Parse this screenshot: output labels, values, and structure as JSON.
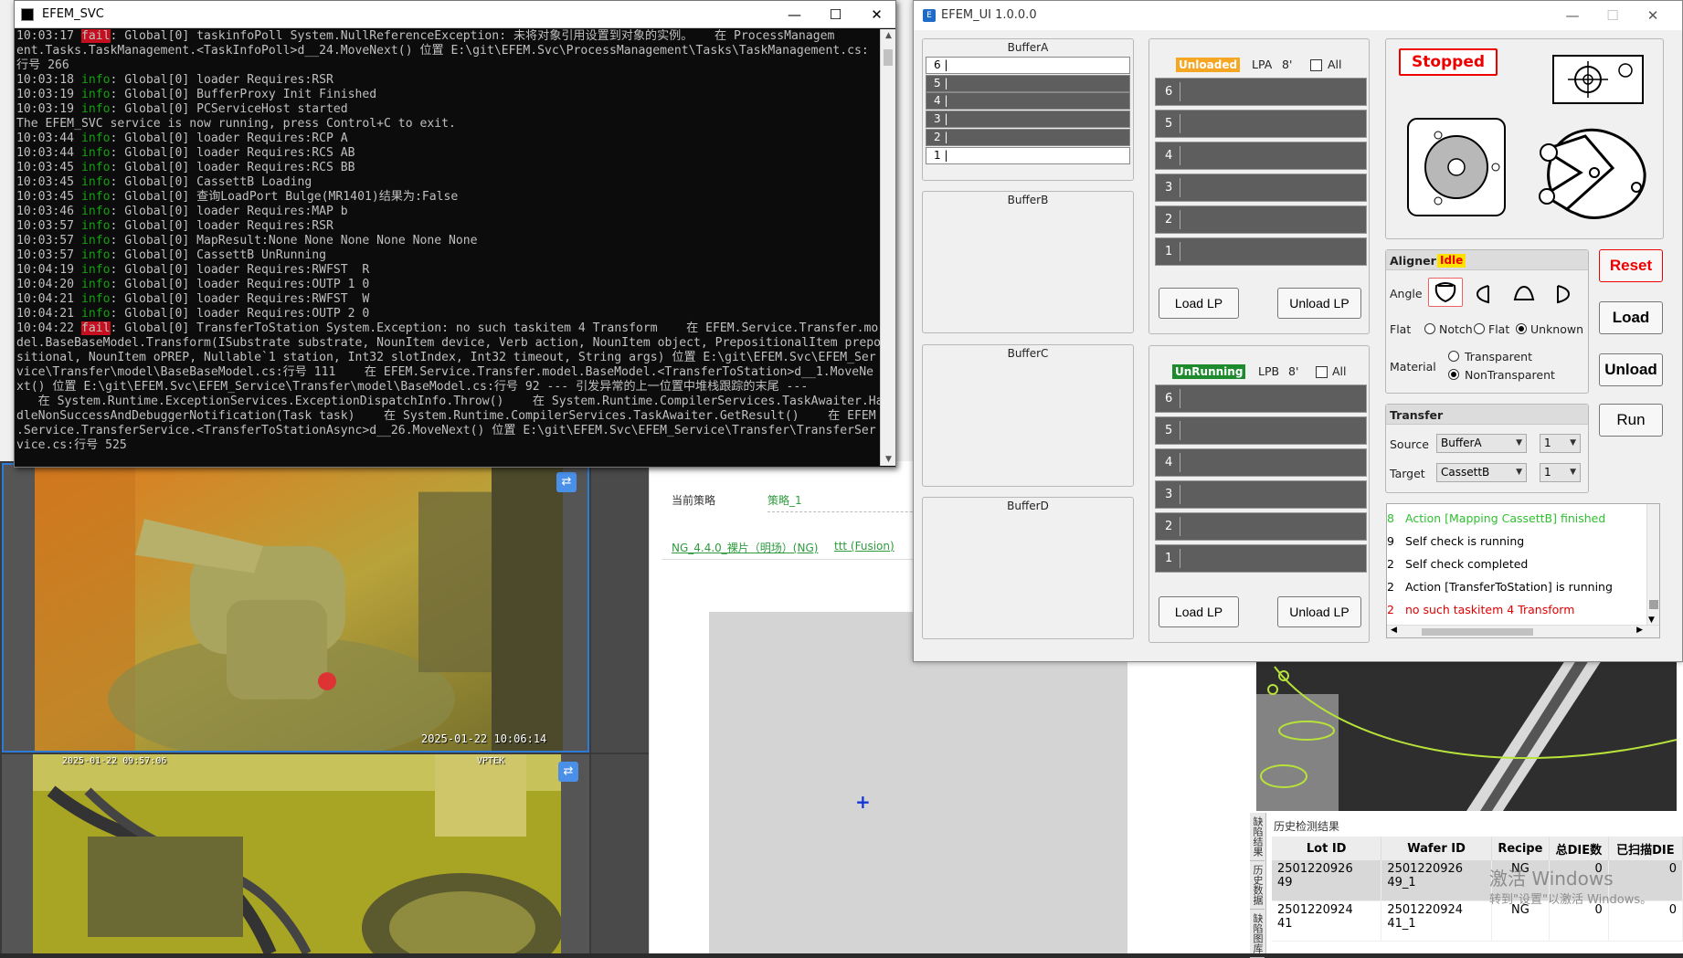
{
  "console": {
    "title": "EFEM_SVC",
    "lines": [
      [
        {
          "t": "10:03:17 "
        },
        {
          "t": "fail",
          "c": "fail"
        },
        {
          "t": ": Global[0] taskinfoPoll System.NullReferenceException: 未将对象引用设置到对象的实例。   在 ProcessManagem"
        }
      ],
      [
        {
          "t": "ent.Tasks.TaskManagement.<TaskInfoPoll>d__24.MoveNext() 位置 E:\\git\\EFEM.Svc\\ProcessManagement\\Tasks\\TaskManagement.cs:"
        }
      ],
      [
        {
          "t": "行号 266"
        }
      ],
      [
        {
          "t": "10:03:18 "
        },
        {
          "t": "info",
          "c": "info"
        },
        {
          "t": ": Global[0] loader Requires:RSR"
        }
      ],
      [
        {
          "t": "10:03:19 "
        },
        {
          "t": "info",
          "c": "info"
        },
        {
          "t": ": Global[0] BufferProxy Init Finished"
        }
      ],
      [
        {
          "t": "10:03:19 "
        },
        {
          "t": "info",
          "c": "info"
        },
        {
          "t": ": Global[0] PCServiceHost started"
        }
      ],
      [
        {
          "t": "The EFEM_SVC service is now running, press Control+C to exit."
        }
      ],
      [
        {
          "t": "10:03:44 "
        },
        {
          "t": "info",
          "c": "info"
        },
        {
          "t": ": Global[0] loader Requires:RCP A"
        }
      ],
      [
        {
          "t": "10:03:44 "
        },
        {
          "t": "info",
          "c": "info"
        },
        {
          "t": ": Global[0] loader Requires:RCS AB"
        }
      ],
      [
        {
          "t": "10:03:45 "
        },
        {
          "t": "info",
          "c": "info"
        },
        {
          "t": ": Global[0] loader Requires:RCS BB"
        }
      ],
      [
        {
          "t": "10:03:45 "
        },
        {
          "t": "info",
          "c": "info"
        },
        {
          "t": ": Global[0] CassettB Loading"
        }
      ],
      [
        {
          "t": "10:03:45 "
        },
        {
          "t": "info",
          "c": "info"
        },
        {
          "t": ": Global[0] 查询LoadPort Bulge(MR1401)结果为:False"
        }
      ],
      [
        {
          "t": "10:03:46 "
        },
        {
          "t": "info",
          "c": "info"
        },
        {
          "t": ": Global[0] loader Requires:MAP b"
        }
      ],
      [
        {
          "t": "10:03:57 "
        },
        {
          "t": "info",
          "c": "info"
        },
        {
          "t": ": Global[0] loader Requires:RSR"
        }
      ],
      [
        {
          "t": "10:03:57 "
        },
        {
          "t": "info",
          "c": "info"
        },
        {
          "t": ": Global[0] MapResult:None None None None None None"
        }
      ],
      [
        {
          "t": "10:03:57 "
        },
        {
          "t": "info",
          "c": "info"
        },
        {
          "t": ": Global[0] CassettB UnRunning"
        }
      ],
      [
        {
          "t": "10:04:19 "
        },
        {
          "t": "info",
          "c": "info"
        },
        {
          "t": ": Global[0] loader Requires:RWFST  R"
        }
      ],
      [
        {
          "t": "10:04:20 "
        },
        {
          "t": "info",
          "c": "info"
        },
        {
          "t": ": Global[0] loader Requires:OUTP 1 0"
        }
      ],
      [
        {
          "t": "10:04:21 "
        },
        {
          "t": "info",
          "c": "info"
        },
        {
          "t": ": Global[0] loader Requires:RWFST  W"
        }
      ],
      [
        {
          "t": "10:04:21 "
        },
        {
          "t": "info",
          "c": "info"
        },
        {
          "t": ": Global[0] loader Requires:OUTP 2 0"
        }
      ],
      [
        {
          "t": "10:04:22 "
        },
        {
          "t": "fail",
          "c": "fail"
        },
        {
          "t": ": Global[0] TransferToStation System.Exception: no such taskitem 4 Transform    在 EFEM.Service.Transfer.mo"
        }
      ],
      [
        {
          "t": "del.BaseBaseModel.Transform(ISubstrate substrate, NounItem device, Verb action, NounItem object, PrepositionalItem prepo"
        }
      ],
      [
        {
          "t": "sitional, NounItem oPREP, Nullable`1 station, Int32 slotIndex, Int32 timeout, String args) 位置 E:\\git\\EFEM.Svc\\EFEM_Ser"
        }
      ],
      [
        {
          "t": "vice\\Transfer\\model\\BaseBaseModel.cs:行号 111    在 EFEM.Service.Transfer.model.BaseModel.<TransferToStation>d__1.MoveNe"
        }
      ],
      [
        {
          "t": "xt() 位置 E:\\git\\EFEM.Svc\\EFEM_Service\\Transfer\\model\\BaseModel.cs:行号 92 --- 引发异常的上一位置中堆栈跟踪的末尾 ---"
        }
      ],
      [
        {
          "t": "   在 System.Runtime.ExceptionServices.ExceptionDispatchInfo.Throw()    在 System.Runtime.CompilerServices.TaskAwaiter.Han"
        }
      ],
      [
        {
          "t": "dleNonSuccessAndDebuggerNotification(Task task)    在 System.Runtime.CompilerServices.TaskAwaiter.GetResult()    在 EFEM"
        }
      ],
      [
        {
          "t": ".Service.TransferService.<TransferToStationAsync>d__26.MoveNext() 位置 E:\\git\\EFEM.Svc\\EFEM_Service\\Transfer\\TransferSer"
        }
      ],
      [
        {
          "t": "vice.cs:行号 525"
        }
      ]
    ]
  },
  "background": {
    "cam1_timestamp": "2025-01-22  10:06:14",
    "cam2_timestamp": "2025-01-22 09:57:06",
    "cam2_brand": "VPTEK",
    "strategy_label": "当前策略",
    "strategy_value": "策略_1",
    "link1": "NG_4.4.0_裸片（明场）(NG)",
    "link2": "ttt (Fusion)",
    "history_title": "历史检测结果",
    "history_tabs": [
      "缺陷结果",
      "历史数据",
      "缺陷图库"
    ],
    "history_cols": [
      "Lot ID",
      "Wafer ID",
      "Recipe",
      "总DIE数",
      "已扫描DIE"
    ],
    "history_rows": [
      [
        "2501220926\n49",
        "2501220926\n49_1",
        "NG",
        "0",
        "0"
      ],
      [
        "2501220924\n41",
        "2501220924\n41_1",
        "NG",
        "0",
        "0"
      ]
    ],
    "watermark_1": "激活 Windows",
    "watermark_2": "转到\"设置\"以激活 Windows。"
  },
  "efem": {
    "title": "EFEM_UI 1.0.0.0",
    "bufferA": {
      "title": "BufferA",
      "slots": [
        {
          "n": "6",
          "state": "empty"
        },
        {
          "n": "5",
          "state": "full"
        },
        {
          "n": "4",
          "state": "full"
        },
        {
          "n": "3",
          "state": "full"
        },
        {
          "n": "2",
          "state": "full"
        },
        {
          "n": "1",
          "state": "empty"
        }
      ]
    },
    "bufferB": {
      "title": "BufferB"
    },
    "bufferC": {
      "title": "BufferC"
    },
    "bufferD": {
      "title": "BufferD"
    },
    "lpa": {
      "status": "Unloaded",
      "status_bg": "#f5a623",
      "label": "LPA",
      "size": "8'",
      "all_label": "All",
      "slots": [
        "6",
        "5",
        "4",
        "3",
        "2",
        "1"
      ],
      "load": "Load LP",
      "unload": "Unload LP"
    },
    "lpb": {
      "status": "UnRunning",
      "status_bg": "#1e8a2e",
      "label": "LPB",
      "size": "8'",
      "all_label": "All",
      "slots": [
        "6",
        "5",
        "4",
        "3",
        "2",
        "1"
      ],
      "load": "Load LP",
      "unload": "Unload LP"
    },
    "state": "Stopped",
    "aligner": {
      "title": "Aligner",
      "status": "Idle",
      "angle_label": "Angle",
      "flat_label": "Flat",
      "flat_options": [
        "Notch",
        "Flat",
        "Unknown"
      ],
      "flat_selected": 2,
      "material_label": "Material",
      "material_options": [
        "Transparent",
        "NonTransparent"
      ],
      "material_selected": 1
    },
    "transfer": {
      "title": "Transfer",
      "source_label": "Source",
      "source": "BufferA",
      "source_slot": "1",
      "target_label": "Target",
      "target": "CassettB",
      "target_slot": "1"
    },
    "buttons": {
      "reset": "Reset",
      "load": "Load",
      "unload": "Unload",
      "run": "Run"
    },
    "log": [
      {
        "n": "8",
        "text": "Action [Mapping CassettB] finished",
        "color": "#2ec02e"
      },
      {
        "n": "9",
        "text": "Self check is running",
        "color": "#000000"
      },
      {
        "n": "2",
        "text": "Self check completed",
        "color": "#000000"
      },
      {
        "n": "2",
        "text": "Action [TransferToStation] is running",
        "color": "#000000"
      },
      {
        "n": "2",
        "text": "no such taskitem 4 Transform",
        "color": "#e00000"
      }
    ]
  }
}
